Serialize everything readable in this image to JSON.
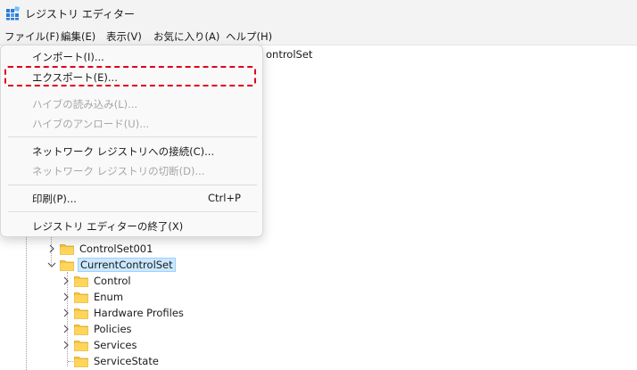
{
  "window": {
    "title": "レジストリ エディター"
  },
  "menubar": {
    "items": [
      "ファイル(F)",
      "編集(E)",
      "表示(V)",
      "お気に入り(A)",
      "ヘルプ(H)"
    ]
  },
  "address": {
    "visible_text": "ontrolSet"
  },
  "file_menu": {
    "import": "インポート(I)...",
    "export": "エクスポート(E)...",
    "load_hive": "ハイブの読み込み(L)...",
    "unload_hive": "ハイブのアンロード(U)...",
    "connect_network": "ネットワーク レジストリへの接続(C)...",
    "disconnect_network": "ネットワーク レジストリの切断(D)...",
    "print": "印刷(P)...",
    "print_shortcut": "Ctrl+P",
    "exit": "レジストリ エディターの終了(X)"
  },
  "tree": {
    "controlset001": "ControlSet001",
    "currentcontrolset": "CurrentControlSet",
    "children": [
      "Control",
      "Enum",
      "Hardware Profiles",
      "Policies",
      "Services",
      "ServiceState"
    ]
  },
  "colors": {
    "highlight_border": "#e0001a",
    "folder_fill": "#f8c33f",
    "selection_bg": "#cce8ff"
  },
  "icons": {
    "app": "registry-editor-icon",
    "folder": "folder-icon",
    "expand": "chevron-right-icon",
    "collapse": "chevron-down-icon"
  }
}
